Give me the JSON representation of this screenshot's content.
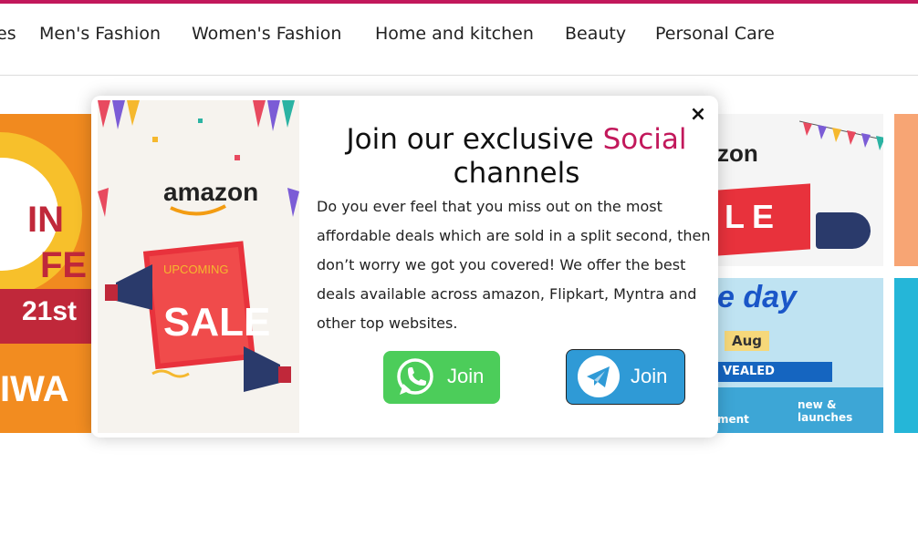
{
  "nav": {
    "items": [
      {
        "name": "nav-item-prev",
        "label": "es"
      },
      {
        "name": "nav-item-mens-fashion",
        "label": "Men's Fashion"
      },
      {
        "name": "nav-item-womens-fashion",
        "label": "Women's Fashion"
      },
      {
        "name": "nav-item-home-kitchen",
        "label": "Home and kitchen"
      },
      {
        "name": "nav-item-beauty",
        "label": "Beauty"
      },
      {
        "name": "nav-item-personal-care",
        "label": "Personal Care"
      }
    ]
  },
  "banners": {
    "left": {
      "t1": "21st",
      "t2": "IWA",
      "t3": "IN",
      "t4": "FE"
    },
    "right_top": {
      "logo": "zon",
      "sale": "LE"
    },
    "right_bottom": {
      "day": "e day",
      "aug": "Aug",
      "revealed": "VEALED",
      "launches": "new & launches",
      "moment": "ment"
    }
  },
  "modal": {
    "close_label": "×",
    "title_prefix": "Join our exclusive ",
    "title_highlight": "Social",
    "title_suffix": "channels",
    "description": "Do you ever feel that you miss out on the most affordable deals which are sold in a split second, then don’t worry we got you covered! We offer the best deals available across amazon, Flipkart, Myntra and other top websites.",
    "image": {
      "brand": "amazon",
      "upcoming": "UPCOMING",
      "sale": "SALE"
    },
    "whatsapp_label": "Join",
    "telegram_label": "Join"
  },
  "colors": {
    "accent": "#c2185b",
    "whatsapp": "#4ccd5a",
    "telegram": "#2f9ad6"
  }
}
